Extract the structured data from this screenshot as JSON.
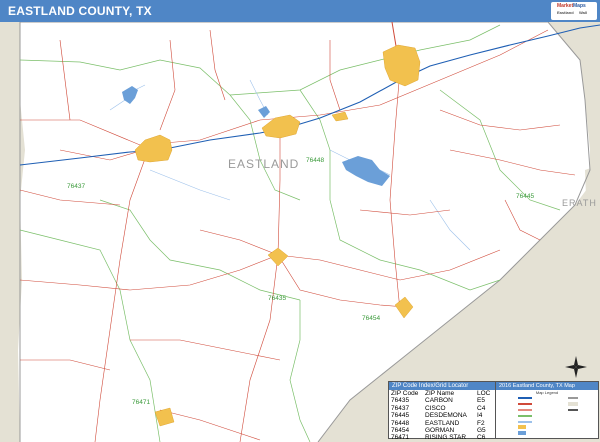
{
  "header": {
    "title": "EASTLAND COUNTY, TX"
  },
  "logo": {
    "line1": "Market",
    "line2": "Maps",
    "line3": "Eastland",
    "line4": "Wall"
  },
  "map": {
    "county_label": "EASTLAND",
    "neighbor_label": "ERATH",
    "zip_labels": [
      {
        "text": "76448"
      },
      {
        "text": "76437"
      },
      {
        "text": "76445"
      },
      {
        "text": "76435"
      },
      {
        "text": "76454"
      },
      {
        "text": "76471"
      }
    ],
    "colors": {
      "header": "#4f86c6",
      "outside": "#e4e1d4",
      "roads": "#d04a3a",
      "zip_boundaries": "#7bbf6a",
      "cities": "#f2c14e",
      "water": "#6b9fd8",
      "highway": "#1f5fb4"
    }
  },
  "zip_locator": {
    "title": "ZIP Code Index/Grid Locator",
    "headers": [
      "ZIP Code",
      "ZIP Name",
      "LOC"
    ],
    "rows": [
      [
        "76435",
        "CARBON",
        "E5"
      ],
      [
        "76437",
        "CISCO",
        "C4"
      ],
      [
        "76445",
        "DESDEMONA",
        "I4"
      ],
      [
        "76448",
        "EASTLAND",
        "F2"
      ],
      [
        "76454",
        "GORMAN",
        "G5"
      ],
      [
        "76471",
        "RISING STAR",
        "C6"
      ]
    ]
  },
  "legend": {
    "title": "2016 Eastland County, TX Map",
    "subtitle": "Map Legend"
  }
}
